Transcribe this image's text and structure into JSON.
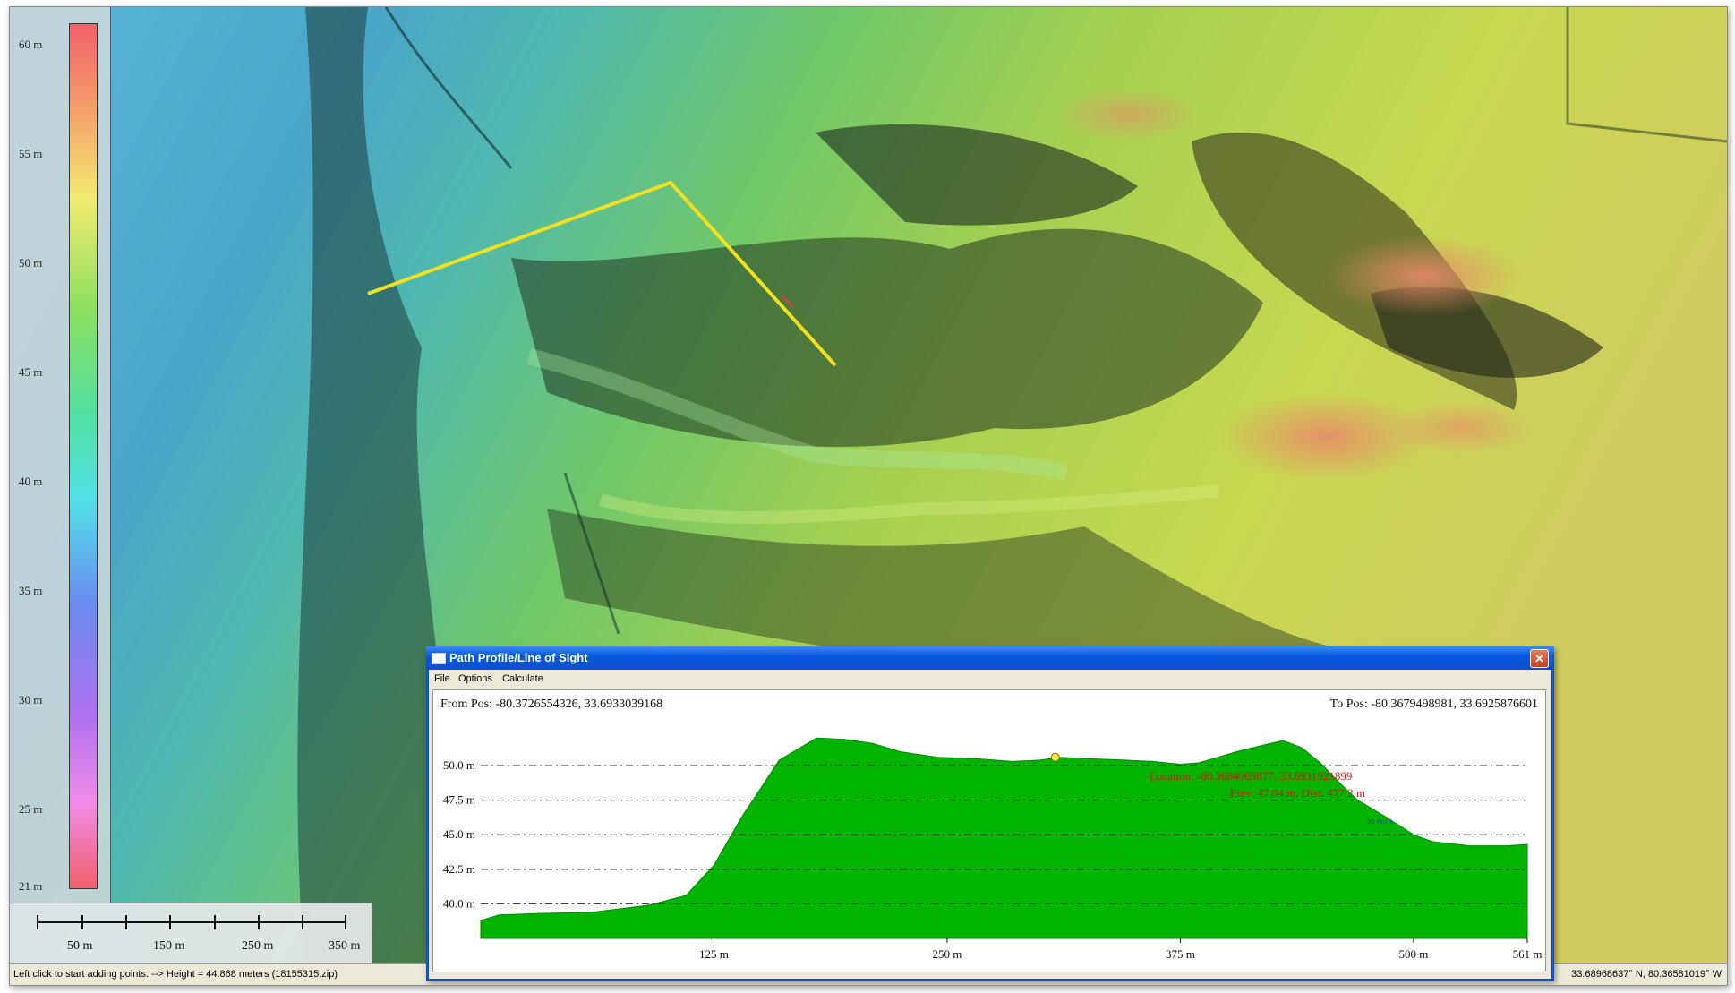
{
  "legend": {
    "labels": [
      "60 m",
      "55 m",
      "50 m",
      "45 m",
      "40 m",
      "35 m",
      "30 m",
      "25 m",
      "21 m"
    ]
  },
  "scalebar": {
    "labels": [
      "50 m",
      "150 m",
      "250 m",
      "350 m"
    ]
  },
  "status": {
    "left": "Left click to start adding points. --> Height = 44.868 meters (18155315.zip)",
    "right": "33.68968637° N, 80.36581019° W"
  },
  "dialog": {
    "title": "Path Profile/Line of Sight",
    "menu": [
      "File",
      "Options",
      "Calculate"
    ],
    "from_pos": "From Pos: -80.3726554326, 33.6933039168",
    "to_pos": "To Pos: -80.3679498981, 33.6925876601",
    "location": "Location: -80.3684969877, 33.6931921899",
    "elev_dist": "Elev: 47.04 m, Dist: 477.2 m",
    "marker": "3D PATH"
  },
  "colors": {
    "profile_fill": "#00b400",
    "title_bar": "#0a4fd0",
    "annotation": "#e01010",
    "path_line": "#f0e020"
  },
  "chart_data": {
    "type": "area",
    "xlabel": "",
    "ylabel": "",
    "xlim": [
      0,
      561
    ],
    "ylim": [
      37.5,
      53.5
    ],
    "x_ticks": [
      "125 m",
      "250 m",
      "375 m",
      "500 m",
      "561 m"
    ],
    "y_ticks": [
      "50.0 m",
      "47.5 m",
      "45.0 m",
      "42.5 m",
      "40.0 m"
    ],
    "x": [
      0,
      10,
      30,
      60,
      90,
      110,
      125,
      140,
      160,
      180,
      195,
      210,
      225,
      245,
      265,
      285,
      300,
      310,
      325,
      345,
      360,
      375,
      385,
      395,
      405,
      420,
      430,
      440,
      450,
      460,
      470,
      485,
      500,
      510,
      530,
      550,
      561
    ],
    "y": [
      38.8,
      39.2,
      39.3,
      39.4,
      39.9,
      40.6,
      42.8,
      46.3,
      50.4,
      52.0,
      51.9,
      51.6,
      51.0,
      50.6,
      50.5,
      50.3,
      50.4,
      50.6,
      50.5,
      50.4,
      50.3,
      50.1,
      50.2,
      50.6,
      51.0,
      51.5,
      51.8,
      51.3,
      50.2,
      48.8,
      47.5,
      46.3,
      45.0,
      44.5,
      44.2,
      44.2,
      44.3
    ],
    "marker_point": {
      "x": 308,
      "y": 50.6
    }
  }
}
